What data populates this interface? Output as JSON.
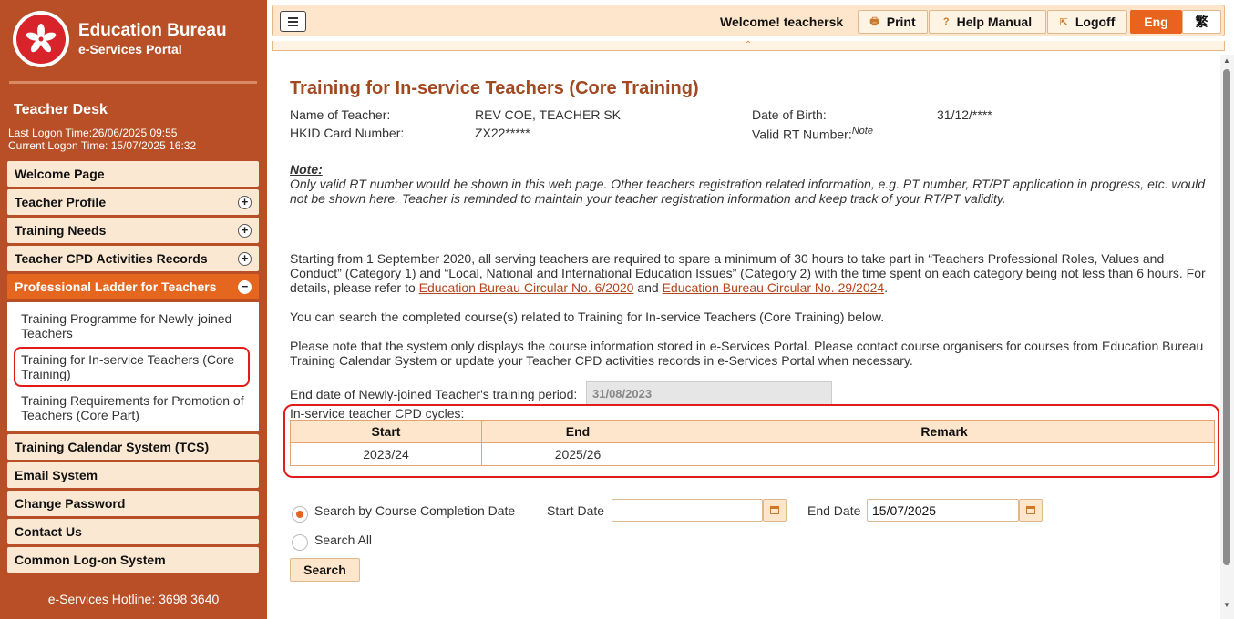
{
  "sidebar": {
    "logo_title": "Education Bureau",
    "logo_subtitle": "e-Services Portal",
    "desk_title": "Teacher Desk",
    "last_logon": "Last Logon Time:26/06/2025 09:55",
    "current_logon": "Current Logon Time: 15/07/2025 16:32",
    "menu": [
      {
        "label": "Welcome Page",
        "expandable": false
      },
      {
        "label": "Teacher Profile",
        "expandable": true
      },
      {
        "label": "Training Needs",
        "expandable": true
      },
      {
        "label": "Teacher CPD Activities Records",
        "expandable": true
      },
      {
        "label": "Professional Ladder for Teachers",
        "expanded": true
      }
    ],
    "submenu": [
      {
        "label": "Training Programme for Newly-joined Teachers"
      },
      {
        "label": "Training for In-service Teachers (Core Training)",
        "current": true
      },
      {
        "label": "Training Requirements for Promotion of Teachers (Core Part)"
      }
    ],
    "menu_after": [
      {
        "label": "Training Calendar System (TCS)"
      },
      {
        "label": "Email System"
      },
      {
        "label": "Change Password"
      },
      {
        "label": "Contact Us"
      },
      {
        "label": "Common Log-on System"
      }
    ],
    "hotline": "e-Services Hotline: 3698 3640",
    "colors": {
      "background": "#b84f26",
      "active": "#e5671f",
      "item": "#fbe8d2"
    }
  },
  "topbar": {
    "welcome": "Welcome! teachersk",
    "print": "Print",
    "help": "Help Manual",
    "logoff": "Logoff",
    "lang_eng": "Eng",
    "lang_chi": "繁"
  },
  "main": {
    "title": "Training for In-service Teachers (Core Training)",
    "name_label": "Name of Teacher:",
    "name_value": "REV COE, TEACHER SK",
    "dob_label": "Date of Birth:",
    "dob_value": "31/12/****",
    "hkid_label": "HKID Card Number:",
    "hkid_value": "ZX22*****",
    "rt_label": "Valid RT Number:",
    "rt_sup": "Note",
    "note_label": "Note:",
    "note_text": "Only valid RT number would be shown in this web page. Other teachers registration related information, e.g. PT number, RT/PT application in progress, etc. would not be shown here. Teacher is reminded to maintain your teacher registration information and keep track of your RT/PT validity.",
    "para1_text": "Starting from 1 September 2020, all serving teachers are required to spare a minimum of 30 hours to take part in “Teachers Professional Roles, Values and Conduct” (Category 1) and “Local, National and International Education Issues” (Category 2) with the time spent on each category being not less than 6 hours. For details, please refer to ",
    "para1_link1": "Education Bureau Circular No. 6/2020",
    "para1_and": " and ",
    "para1_link2": "Education Bureau Circular No. 29/2024",
    "para1_end": ".",
    "para2": "You can search the completed course(s) related to Training for In-service Teachers (Core Training) below.",
    "para3": "Please note that the system only displays the course information stored in e-Services Portal. Please contact course organisers for courses from Education Bureau Training Calendar System or update your Teacher CPD activities records in e-Services Portal when necessary.",
    "end_label": "End date of Newly-joined Teacher's training period:",
    "end_value": "31/08/2023",
    "cpd_caption": "In-service teacher CPD cycles:",
    "cpd_headers": [
      "Start",
      "End",
      "Remark"
    ],
    "cpd_rows": [
      [
        "2023/24",
        "2025/26",
        ""
      ]
    ],
    "search_by_date": "Search by Course Completion Date",
    "start_date_label": "Start Date",
    "start_date_value": "",
    "end_date_label": "End Date",
    "end_date_value": "15/07/2025",
    "search_all": "Search All",
    "search_button": "Search"
  }
}
